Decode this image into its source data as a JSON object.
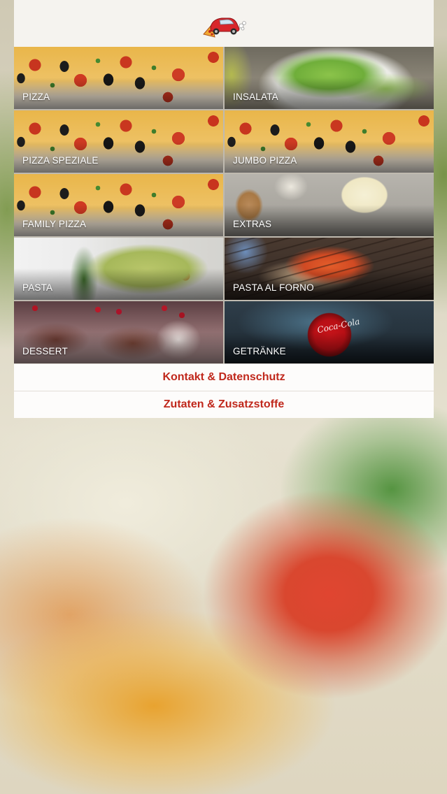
{
  "header": {
    "logo_icon": "pizza-delivery-car-logo"
  },
  "categories": [
    {
      "label": "PIZZA"
    },
    {
      "label": "INSALATA"
    },
    {
      "label": "PIZZA SPEZIALE"
    },
    {
      "label": "JUMBO PIZZA"
    },
    {
      "label": "FAMILY PIZZA"
    },
    {
      "label": "EXTRAS"
    },
    {
      "label": "PASTA"
    },
    {
      "label": "PASTA AL FORNO"
    },
    {
      "label": "DESSERT"
    },
    {
      "label": "GETRÄNKE"
    }
  ],
  "drinks_tile": {
    "cap_brand": "Coca-Cola"
  },
  "links": {
    "contact_privacy": "Kontakt & Datenschutz",
    "ingredients_additives": "Zutaten & Zusatzstoffe"
  },
  "colors": {
    "link_text": "#c0281c",
    "header_bg": "#f5f3ef"
  }
}
